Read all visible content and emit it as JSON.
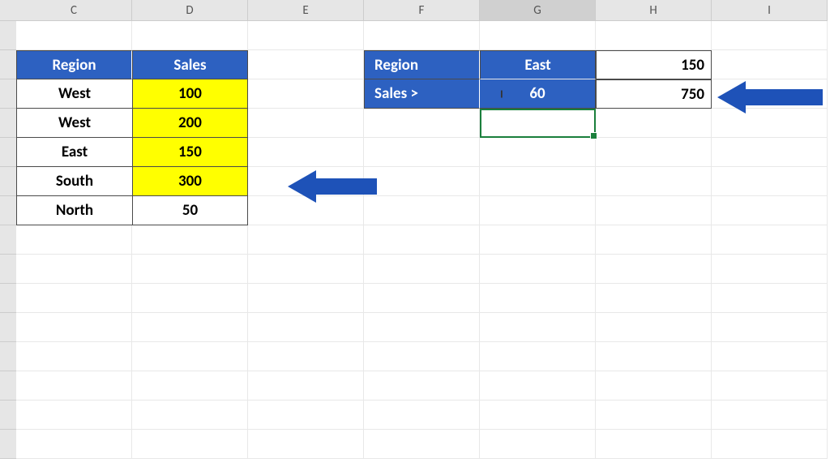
{
  "columns": [
    "C",
    "D",
    "E",
    "F",
    "G",
    "H",
    "I"
  ],
  "selected_column": "G",
  "table1": {
    "headers": {
      "region": "Region",
      "sales": "Sales"
    },
    "rows": [
      {
        "region": "West",
        "sales": "100",
        "highlight": true
      },
      {
        "region": "West",
        "sales": "200",
        "highlight": true
      },
      {
        "region": "East",
        "sales": "150",
        "highlight": true
      },
      {
        "region": "South",
        "sales": "300",
        "highlight": true
      },
      {
        "region": "North",
        "sales": "50",
        "highlight": false
      }
    ]
  },
  "criteria": {
    "labels": {
      "region": "Region",
      "sales": "Sales >"
    },
    "values": {
      "region": "East",
      "sales": "60"
    }
  },
  "results": {
    "r1": "150",
    "r2": "750"
  },
  "selected_cell": "G5",
  "arrows": {
    "color": "#1e52b8"
  }
}
